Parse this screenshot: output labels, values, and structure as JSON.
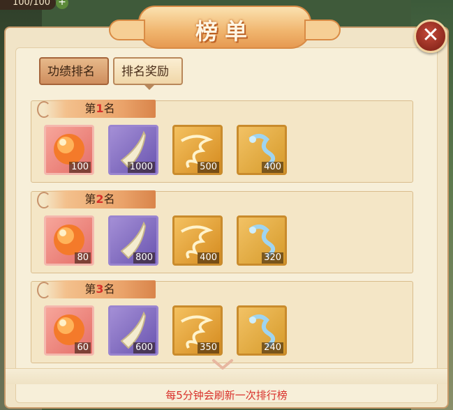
{
  "hud": {
    "counter": "100/100"
  },
  "panel": {
    "title": "榜单"
  },
  "tabs": [
    {
      "label": "功绩排名",
      "active": false
    },
    {
      "label": "排名奖励",
      "active": true
    }
  ],
  "ranks": [
    {
      "prefix": "第",
      "number": "1",
      "suffix": "名",
      "rewards": [
        {
          "icon": "fire-orb-icon",
          "count": "100"
        },
        {
          "icon": "horn-icon",
          "count": "1000"
        },
        {
          "icon": "gold-cloud-icon",
          "count": "500"
        },
        {
          "icon": "dragon-icon",
          "count": "400"
        }
      ]
    },
    {
      "prefix": "第",
      "number": "2",
      "suffix": "名",
      "rewards": [
        {
          "icon": "fire-orb-icon",
          "count": "80"
        },
        {
          "icon": "horn-icon",
          "count": "800"
        },
        {
          "icon": "gold-cloud-icon",
          "count": "400"
        },
        {
          "icon": "dragon-icon",
          "count": "320"
        }
      ]
    },
    {
      "prefix": "第",
      "number": "3",
      "suffix": "名",
      "rewards": [
        {
          "icon": "fire-orb-icon",
          "count": "60"
        },
        {
          "icon": "horn-icon",
          "count": "600"
        },
        {
          "icon": "gold-cloud-icon",
          "count": "350"
        },
        {
          "icon": "dragon-icon",
          "count": "240"
        }
      ]
    }
  ],
  "footer": {
    "notice": "每5分钟会刷新一次排行榜"
  },
  "colors": {
    "accent_red": "#d8302a",
    "panel_bg": "#f1e4c7"
  }
}
